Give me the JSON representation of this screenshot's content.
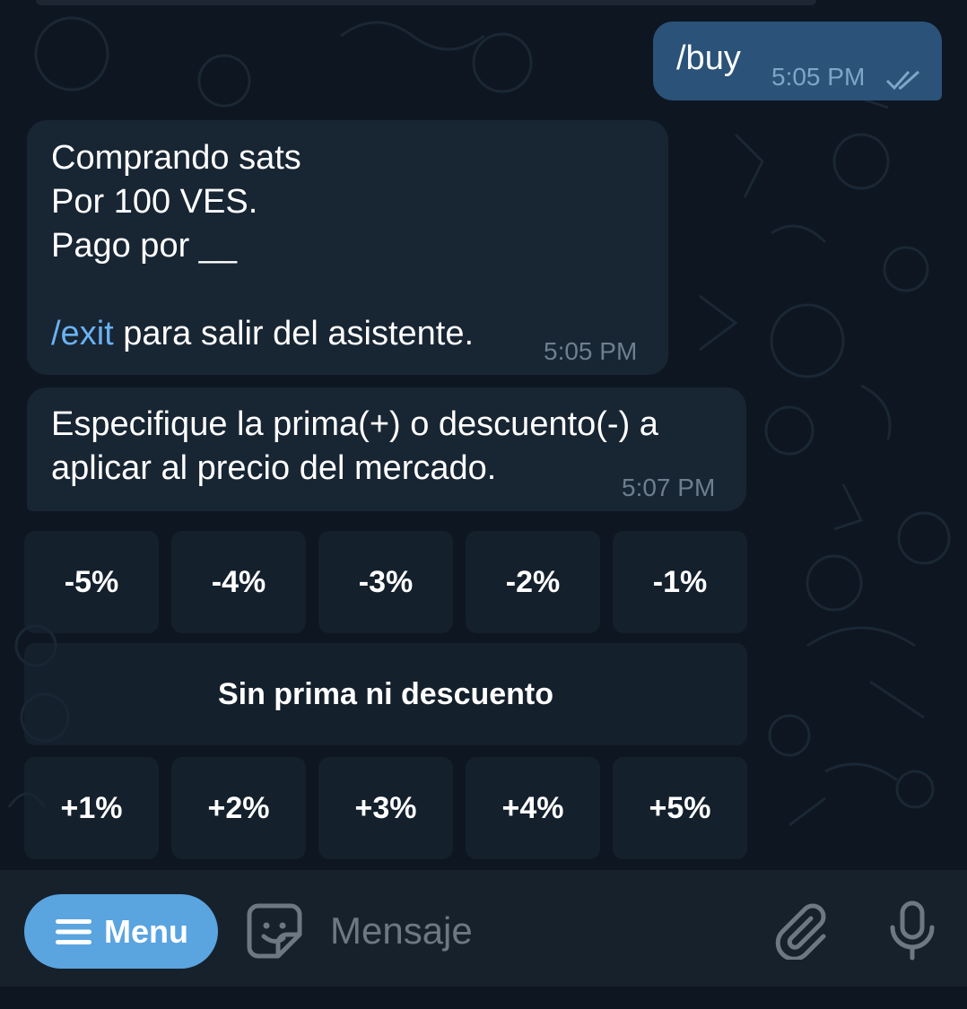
{
  "chat": {
    "messages": [
      {
        "direction": "outgoing",
        "text": "/buy",
        "time": "5:05 PM",
        "status": "read-double-check"
      },
      {
        "direction": "incoming",
        "lines": [
          "Comprando sats",
          "Por 100 VES.",
          "Pago por __"
        ],
        "command": "/exit",
        "command_suffix": " para salir del asistente.",
        "time": "5:05 PM"
      },
      {
        "direction": "incoming",
        "lines": [
          "Especifique la prima(+) o descuento(-) a",
          "aplicar al precio del mercado."
        ],
        "time": "5:07 PM"
      }
    ],
    "keyboard": {
      "row1": [
        "-5%",
        "-4%",
        "-3%",
        "-2%",
        "-1%"
      ],
      "row2": [
        "Sin prima ni descuento"
      ],
      "row3": [
        "+1%",
        "+2%",
        "+3%",
        "+4%",
        "+5%"
      ]
    }
  },
  "composer": {
    "menu_label": "Menu",
    "placeholder": "Mensaje",
    "icons": [
      "menu-lines-icon",
      "sticker-icon",
      "paperclip-icon",
      "microphone-icon"
    ]
  },
  "colors": {
    "background": "#0e1621",
    "outgoing_bubble": "#2b5278",
    "incoming_bubble": "#182533",
    "link": "#6ab2f2",
    "menu_button": "#5aa4e0"
  }
}
